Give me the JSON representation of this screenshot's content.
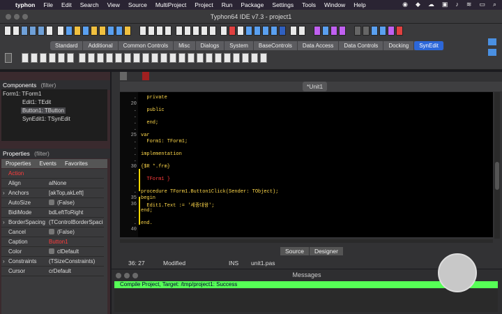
{
  "menubar": {
    "apple": "",
    "app": "typhon",
    "items": [
      "File",
      "Edit",
      "Search",
      "View",
      "Source",
      "MultiProject",
      "Project",
      "Run",
      "Package",
      "Settings",
      "Tools",
      "Window",
      "Help"
    ]
  },
  "window": {
    "title": "Typhon64 IDE v7.3 - project1"
  },
  "palette": {
    "tabs": [
      "Standard",
      "Additional",
      "Common Controls",
      "Misc",
      "Dialogs",
      "System",
      "BaseControls",
      "Data Access",
      "Data Controls",
      "Docking",
      "SynEdit"
    ],
    "active_tab": "SynEdit"
  },
  "components_panel": {
    "title": "Components",
    "filter": "(filter)",
    "tree": [
      {
        "label": "Form1: TForm1",
        "level": 0
      },
      {
        "label": "Edit1: TEdit",
        "level": 1
      },
      {
        "label": "Button1: TButton",
        "level": 1,
        "selected": true
      },
      {
        "label": "SynEdit1: TSynEdit",
        "level": 1
      }
    ]
  },
  "properties_panel": {
    "title": "Properties",
    "filter": "(filter)",
    "tabs": [
      "Properties",
      "Events",
      "Favorites"
    ],
    "rows": [
      {
        "name": "Action",
        "value": ""
      },
      {
        "name": "Align",
        "value": "alNone"
      },
      {
        "name": "Anchors",
        "value": "[akTop,akLeft]",
        "expandable": true
      },
      {
        "name": "AutoSize",
        "value": "(False)",
        "checkbox": true
      },
      {
        "name": "BidiMode",
        "value": "bdLeftToRight"
      },
      {
        "name": "BorderSpacing",
        "value": "(TControlBorderSpacing)",
        "expandable": true
      },
      {
        "name": "Cancel",
        "value": "(False)",
        "checkbox": true
      },
      {
        "name": "Caption",
        "value": "Button1"
      },
      {
        "name": "Color",
        "value": "clDefault",
        "checkbox": true
      },
      {
        "name": "Constraints",
        "value": "(TSizeConstraints)",
        "expandable": true
      },
      {
        "name": "Cursor",
        "value": "crDefault"
      }
    ]
  },
  "editor": {
    "tab": "*Unit1",
    "lines": [
      {
        "no": ".",
        "text": "  private"
      },
      {
        "no": "20",
        "text": ""
      },
      {
        "no": ".",
        "text": "  public"
      },
      {
        "no": ".",
        "text": ""
      },
      {
        "no": ".",
        "text": "  end;"
      },
      {
        "no": ".",
        "text": ""
      },
      {
        "no": "25",
        "text": "var"
      },
      {
        "no": ".",
        "text": "  Form1: TForm1;"
      },
      {
        "no": ".",
        "text": ""
      },
      {
        "no": ".",
        "text": "implementation"
      },
      {
        "no": ".",
        "text": ""
      },
      {
        "no": "30",
        "text": "{$R *.frm}"
      },
      {
        "no": ".",
        "text": ""
      },
      {
        "no": ".",
        "text": "  TForm1 }"
      },
      {
        "no": ".",
        "text": ""
      },
      {
        "no": ".",
        "text": "procedure TForm1.Button1Click(Sender: TObject);"
      },
      {
        "no": "35",
        "text": "begin"
      },
      {
        "no": "36",
        "text": "  Edit1.Text := '세종대왕';"
      },
      {
        "no": ".",
        "text": "end;"
      },
      {
        "no": ".",
        "text": ""
      },
      {
        "no": ".",
        "text": "end."
      },
      {
        "no": "40",
        "text": ""
      }
    ],
    "bottom_tabs": [
      "Source",
      "Designer"
    ]
  },
  "statusbar": {
    "pos": "36: 27",
    "modified": "Modified",
    "mode": "INS",
    "file": "unit1.pas"
  },
  "messages": {
    "title": "Messages",
    "line": "Compile Project, Target: /tmp/project1: Success"
  },
  "colors": {
    "accent": "#2c67d9",
    "success": "#56ff56",
    "keyword": "#ffd84a",
    "error": "#ff3c3c"
  }
}
